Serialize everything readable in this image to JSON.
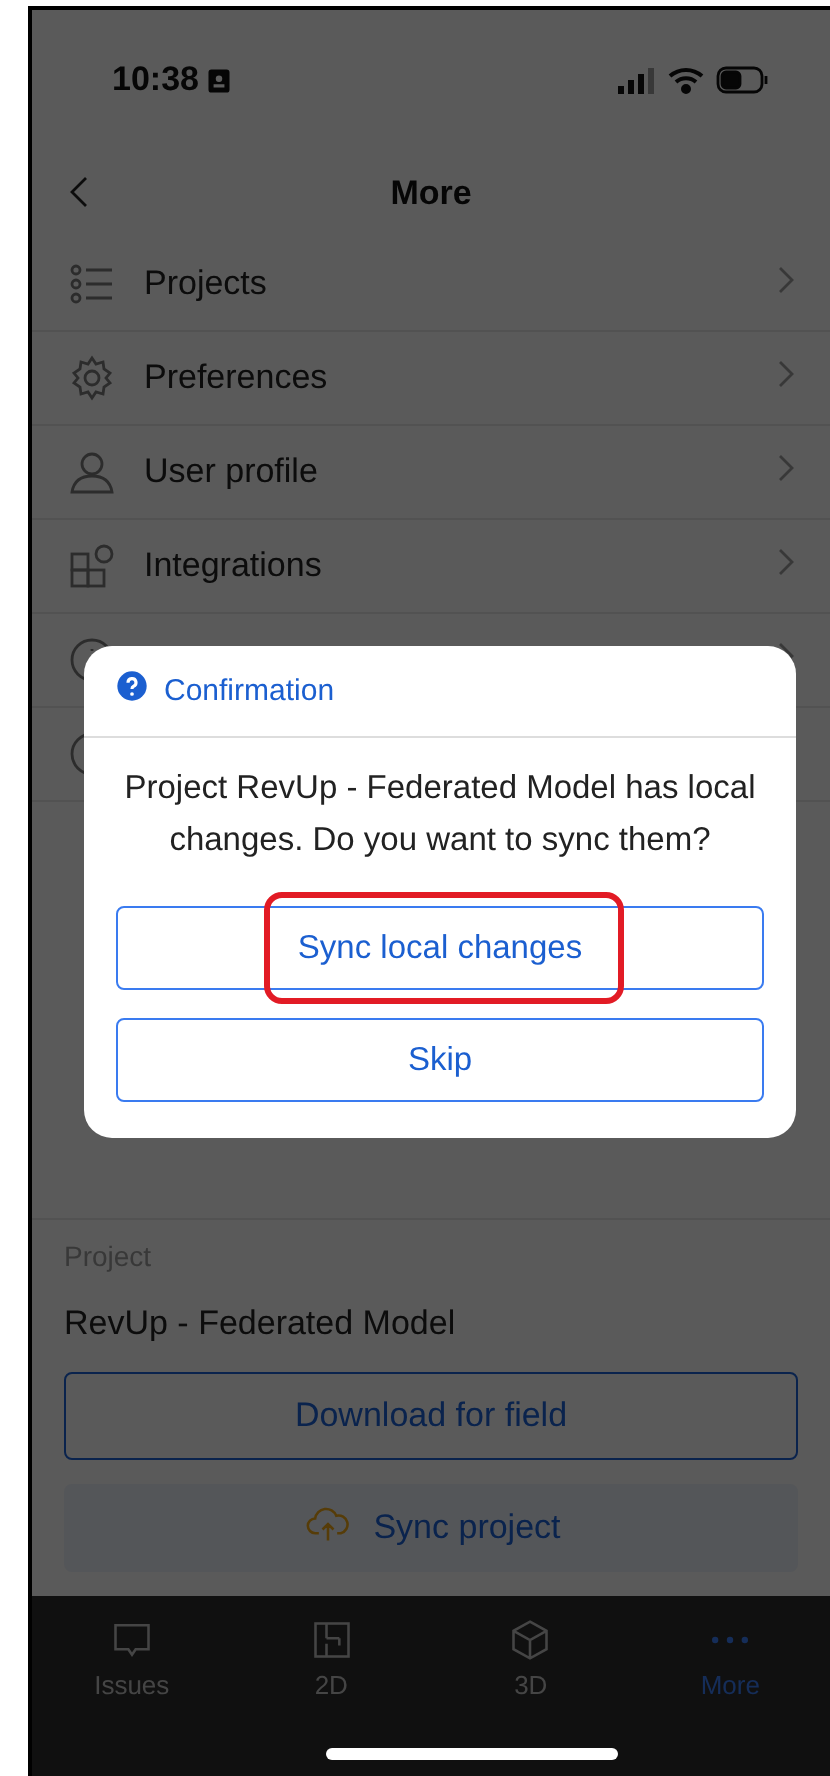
{
  "status_bar": {
    "time": "10:38"
  },
  "nav": {
    "title": "More"
  },
  "menu": [
    {
      "kind": "list",
      "label": "Projects"
    },
    {
      "kind": "gear",
      "label": "Preferences"
    },
    {
      "kind": "person",
      "label": "User profile"
    },
    {
      "kind": "apps",
      "label": "Integrations"
    },
    {
      "kind": "info"
    },
    {
      "kind": "circle"
    }
  ],
  "project": {
    "label": "Project",
    "name": "RevUp - Federated Model"
  },
  "actions": [
    {
      "kind": "outline",
      "label": "Download for field"
    },
    {
      "kind": "sync",
      "label": "Sync project"
    }
  ],
  "tabs": [
    {
      "kind": "issues",
      "label": "Issues",
      "selected": false
    },
    {
      "kind": "plan",
      "label": "2D",
      "selected": false
    },
    {
      "kind": "cube",
      "label": "3D",
      "selected": false
    },
    {
      "kind": "more",
      "label": "More",
      "selected": true
    }
  ],
  "dialog": {
    "title": "Confirmation",
    "message": "Project RevUp - Federated Model has local changes. Do you want to sync them?",
    "buttons": [
      {
        "label": "Sync local changes",
        "highlighted": true
      },
      {
        "label": "Skip",
        "highlighted": false
      }
    ]
  }
}
